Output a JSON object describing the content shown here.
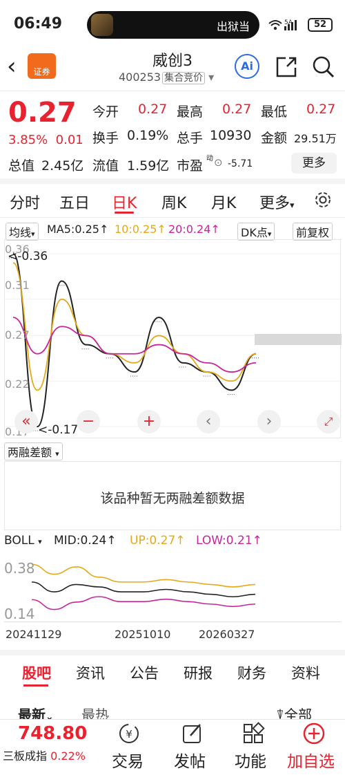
{
  "status_bar": {
    "time": "06:49",
    "media_text": "出狱当",
    "network": "5A",
    "battery": "52"
  },
  "header": {
    "brand_label": "证券",
    "title": "威创3",
    "code": "400253",
    "auction_tag": "集合竞价",
    "ai_label": "Ai"
  },
  "quote": {
    "price": "0.27",
    "change_pct": "3.85%",
    "change": "0.01",
    "open_label": "今开",
    "open": "0.27",
    "high_label": "最高",
    "high": "0.27",
    "low_label": "最低",
    "low": "0.27",
    "turnover_label": "换手",
    "turnover": "0.19%",
    "volume_label": "总手",
    "volume": "10930",
    "amount_label": "金额",
    "amount": "29.51万",
    "mktcap_label": "总值",
    "mktcap": "2.45亿",
    "float_label": "流值",
    "float_cap": "1.59亿",
    "pe_label": "市盈",
    "pe_sup": "动",
    "pe": "-5.71",
    "more_label": "更多"
  },
  "period_tabs": [
    "分时",
    "五日",
    "日K",
    "周K",
    "月K",
    "更多"
  ],
  "active_period": "日K",
  "ma_bar": {
    "select": "均线",
    "ma5": "MA5:0.25",
    "ma10": "10:0.25",
    "ma20": "20:0.24",
    "dk": "DK点",
    "adjust": "前复权"
  },
  "kline_axis": {
    "y_labels": [
      "0.36",
      "0.31",
      "0.27",
      "0.22",
      "0.17"
    ],
    "max_note": "<-0.36",
    "min_note": "<-0.17"
  },
  "rz": {
    "select": "两融差额",
    "empty_text": "该品种暂无两融差额数据"
  },
  "boll": {
    "select": "BOLL",
    "mid": "MID:0.24",
    "up": "UP:0.27",
    "low": "LOW:0.21",
    "y_top": "0.38",
    "y_bottom": "0.14"
  },
  "dates": [
    "20241129",
    "20251010",
    "20260327"
  ],
  "news_tabs": [
    "股吧",
    "资讯",
    "公告",
    "研报",
    "财务",
    "资料"
  ],
  "active_news_tab": "股吧",
  "sort": {
    "latest": "最新",
    "hottest": "最热",
    "filter": "全部"
  },
  "bottom_bar": {
    "index_value": "748.80",
    "index_name": "三板成指",
    "index_change": "0.22%",
    "items": [
      {
        "label": "交易",
        "icon": "yen-exchange-icon"
      },
      {
        "label": "发帖",
        "icon": "edit-icon"
      },
      {
        "label": "功能",
        "icon": "grid-icon"
      },
      {
        "label": "加自选",
        "icon": "plus-circle-icon"
      }
    ]
  },
  "chart_data": {
    "type": "line",
    "title": "",
    "ylim": [
      0.17,
      0.36
    ],
    "x": [
      "20241129",
      "20251010",
      "20260327"
    ],
    "series": [
      {
        "name": "MA5",
        "values": [
          0.36,
          0.17,
          0.33,
          0.26,
          0.25,
          0.23,
          0.29,
          0.24,
          0.23,
          0.21,
          0.25
        ]
      },
      {
        "name": "10",
        "values": [
          0.35,
          0.21,
          0.31,
          0.27,
          0.25,
          0.24,
          0.27,
          0.25,
          0.23,
          0.22,
          0.25
        ]
      },
      {
        "name": "20",
        "values": [
          0.29,
          0.25,
          0.28,
          0.27,
          0.25,
          0.25,
          0.26,
          0.25,
          0.24,
          0.23,
          0.24
        ]
      }
    ]
  }
}
